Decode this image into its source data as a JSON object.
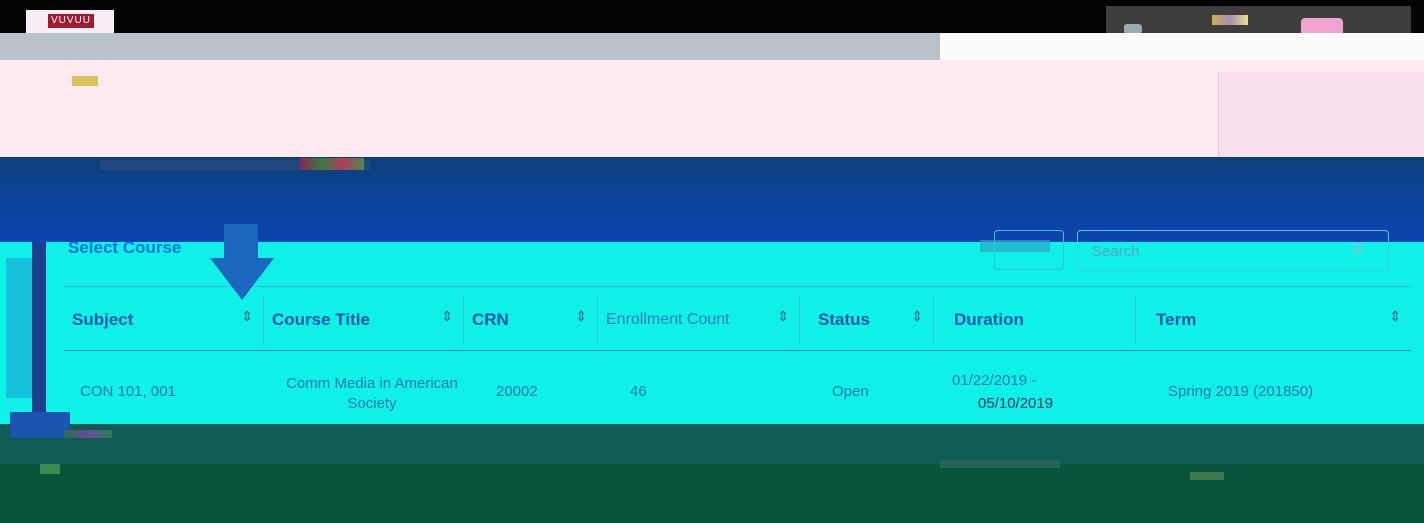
{
  "logo": {
    "text": "VUVUU"
  },
  "panel": {
    "title": "Select Course",
    "search_placeholder": "Search"
  },
  "table": {
    "columns": [
      {
        "label": "Subject",
        "sortable": true
      },
      {
        "label": "Course Title",
        "sortable": true
      },
      {
        "label": "CRN",
        "sortable": true
      },
      {
        "label": "Enrollment Count",
        "sortable": true
      },
      {
        "label": "Status",
        "sortable": true
      },
      {
        "label": "Duration",
        "sortable": false
      },
      {
        "label": "Term",
        "sortable": true
      }
    ],
    "rows": [
      {
        "subject": "CON 101, 001",
        "course_title": "Comm Media in American Society",
        "crn": "20002",
        "enrollment": "46",
        "status": "Open",
        "duration_start": "01/22/2019 -",
        "duration_end": "05/10/2019",
        "term": "Spring 2019 (201850)"
      }
    ]
  },
  "colors": {
    "accent": "#1476d6",
    "panel_bg": "#0df1e7",
    "banner": "#0c44b0"
  },
  "icons": {
    "sort": "sort-updown-icon",
    "search": "search-icon"
  }
}
